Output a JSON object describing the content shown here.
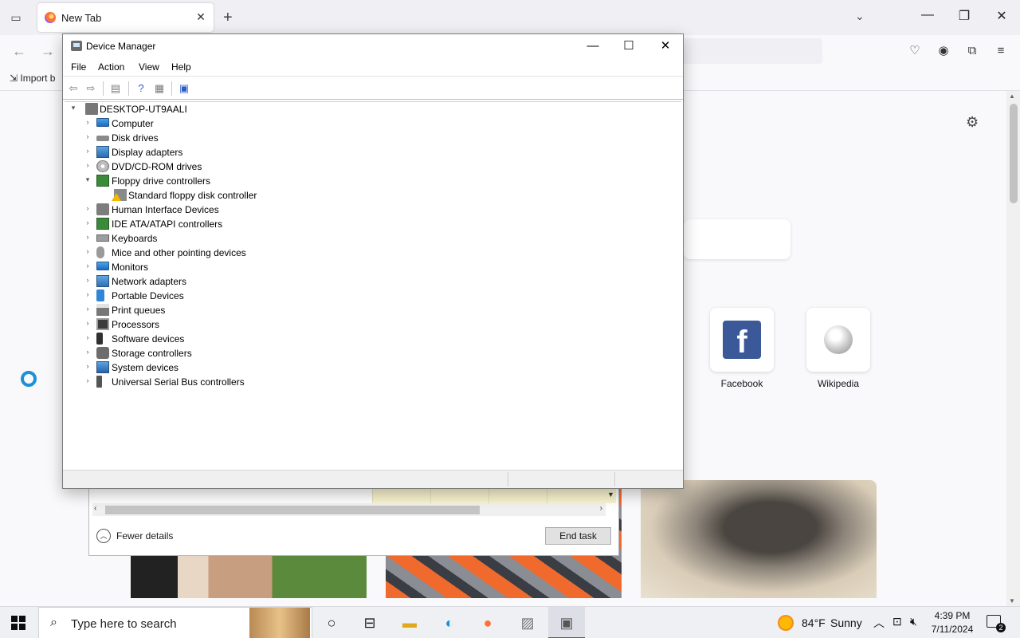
{
  "browser": {
    "tab_title": "New Tab",
    "tab_close": "✕",
    "new_tab": "+",
    "list_tabs": "⌄",
    "import_label": "Import b",
    "shortcuts": [
      {
        "label": "Facebook",
        "icon": "facebook-icon"
      },
      {
        "label": "Wikipedia",
        "icon": "wikipedia-icon"
      }
    ]
  },
  "device_manager": {
    "title": "Device Manager",
    "window_buttons": {
      "minimize": "—",
      "maximize": "☐",
      "close": "✕"
    },
    "menu": [
      "File",
      "Action",
      "View",
      "Help"
    ],
    "toolbar_icons": [
      "back-icon",
      "forward-icon",
      "properties-icon",
      "help-icon",
      "view-icon",
      "scan-hardware-icon"
    ],
    "tree": {
      "root": "DESKTOP-UT9AALI",
      "categories": [
        {
          "label": "Computer",
          "icon": "computer-icon",
          "expanded": false
        },
        {
          "label": "Disk drives",
          "icon": "disk-drive-icon",
          "expanded": false
        },
        {
          "label": "Display adapters",
          "icon": "display-adapter-icon",
          "expanded": false
        },
        {
          "label": "DVD/CD-ROM drives",
          "icon": "cdrom-icon",
          "expanded": false
        },
        {
          "label": "Floppy drive controllers",
          "icon": "floppy-controller-icon",
          "expanded": true
        },
        {
          "label": "Standard floppy disk controller",
          "icon": "warning-device-icon",
          "child": true
        },
        {
          "label": "Human Interface Devices",
          "icon": "hid-icon",
          "expanded": false
        },
        {
          "label": "IDE ATA/ATAPI controllers",
          "icon": "ide-controller-icon",
          "expanded": false
        },
        {
          "label": "Keyboards",
          "icon": "keyboard-icon",
          "expanded": false
        },
        {
          "label": "Mice and other pointing devices",
          "icon": "mouse-icon",
          "expanded": false
        },
        {
          "label": "Monitors",
          "icon": "monitor-icon",
          "expanded": false
        },
        {
          "label": "Network adapters",
          "icon": "network-adapter-icon",
          "expanded": false
        },
        {
          "label": "Portable Devices",
          "icon": "portable-device-icon",
          "expanded": false
        },
        {
          "label": "Print queues",
          "icon": "printer-icon",
          "expanded": false
        },
        {
          "label": "Processors",
          "icon": "processor-icon",
          "expanded": false
        },
        {
          "label": "Software devices",
          "icon": "software-device-icon",
          "expanded": false
        },
        {
          "label": "Storage controllers",
          "icon": "storage-controller-icon",
          "expanded": false
        },
        {
          "label": "System devices",
          "icon": "system-device-icon",
          "expanded": false
        },
        {
          "label": "Universal Serial Bus controllers",
          "icon": "usb-icon",
          "expanded": false
        }
      ]
    }
  },
  "task_manager": {
    "fewer_details": "Fewer details",
    "end_task": "End task"
  },
  "taskbar": {
    "search_placeholder": "Type here to search",
    "weather_temp": "84°F",
    "weather_cond": "Sunny",
    "time": "4:39 PM",
    "date": "7/11/2024",
    "notification_count": "2"
  },
  "colors": {
    "accent": "#2b63c9",
    "warning": "#f5b800",
    "facebook": "#3b5998"
  }
}
